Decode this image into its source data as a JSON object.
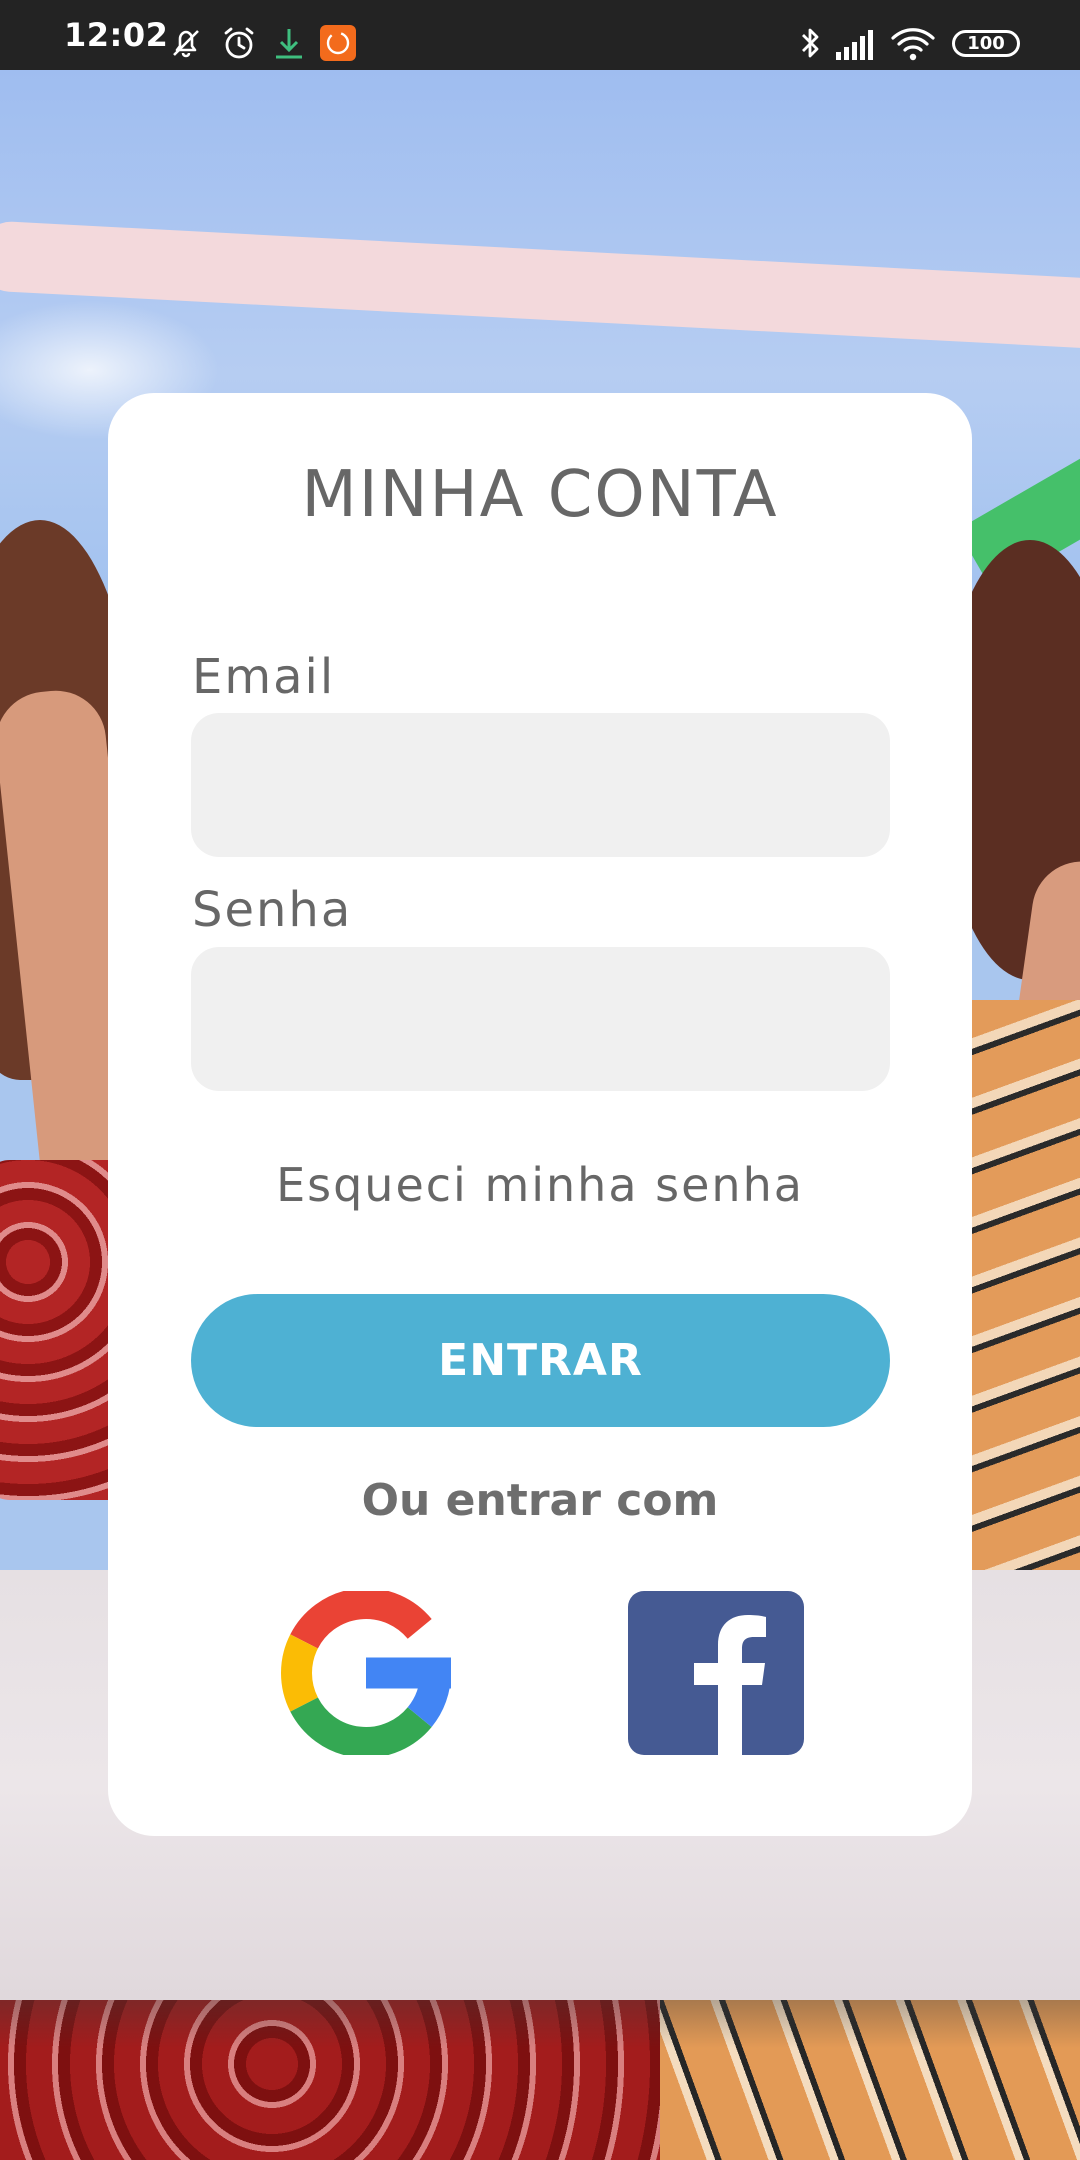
{
  "status_bar": {
    "time": "12:02",
    "battery": "100",
    "icons": [
      "muted-notification-icon",
      "alarm-icon",
      "download-icon",
      "app-notification-icon",
      "bluetooth-icon",
      "signal-icon",
      "wifi-icon",
      "battery-icon"
    ]
  },
  "login": {
    "title": "MINHA CONTA",
    "email_label": "Email",
    "email_value": "",
    "password_label": "Senha",
    "password_value": "",
    "forgot_password": "Esqueci minha senha",
    "submit_label": "ENTRAR",
    "alt_login_text": "Ou entrar com",
    "social": [
      "google-icon",
      "facebook-icon"
    ]
  },
  "colors": {
    "accent": "#4eb1d3",
    "text_gray": "#676767",
    "input_bg": "#f0f0f0",
    "facebook_blue": "#455a93",
    "status_bar_bg": "#232323"
  }
}
